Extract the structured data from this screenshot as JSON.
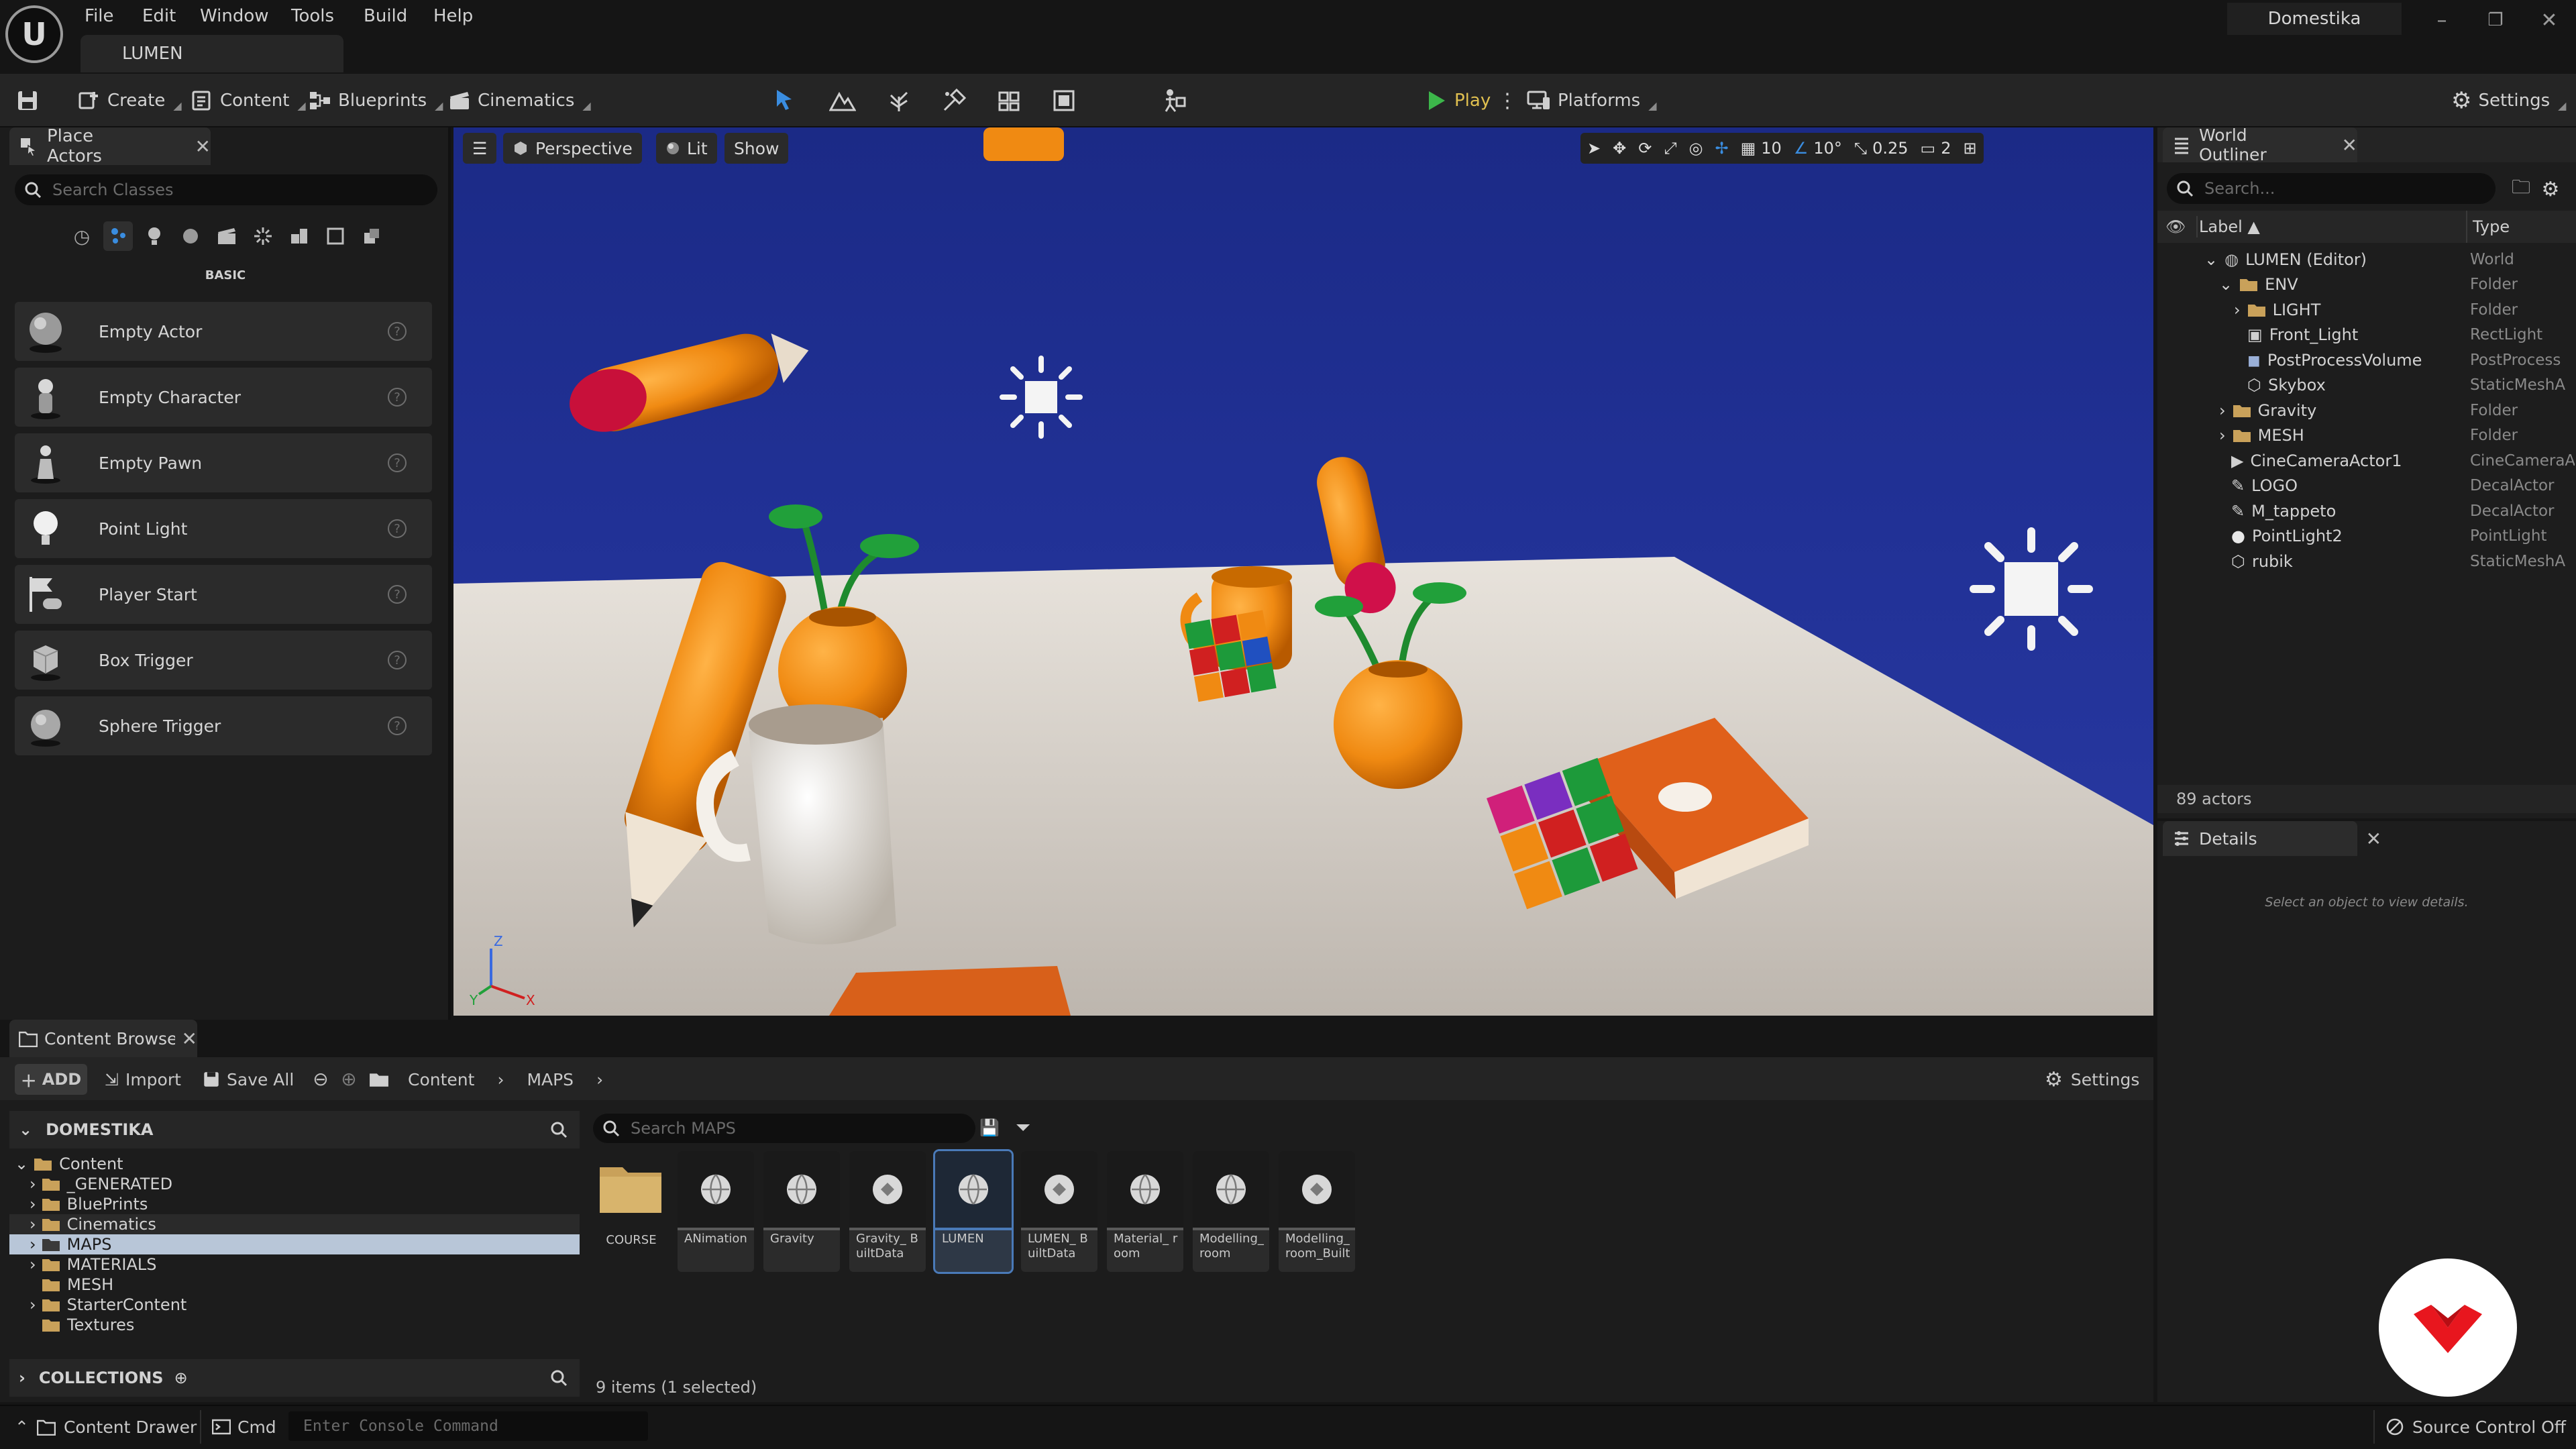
{
  "app": {
    "logo_letter": "U",
    "level_tab": "LUMEN",
    "user": "Domestika"
  },
  "menu": [
    "File",
    "Edit",
    "Window",
    "Tools",
    "Build",
    "Help"
  ],
  "toolbar": {
    "create": "Create",
    "content": "Content",
    "blueprints": "Blueprints",
    "cinematics": "Cinematics",
    "play": "Play",
    "platforms": "Platforms",
    "settings": "Settings"
  },
  "place_actors": {
    "title": "Place Actors",
    "search_placeholder": "Search Classes",
    "category": "BASIC",
    "items": [
      "Empty Actor",
      "Empty Character",
      "Empty Pawn",
      "Point Light",
      "Player Start",
      "Box Trigger",
      "Sphere Trigger"
    ]
  },
  "viewport": {
    "perspective": "Perspective",
    "lit": "Lit",
    "show": "Show",
    "grid_size": "10",
    "rotation_snap": "10°",
    "scale_snap": "0.25",
    "camera_speed": "2",
    "axis_z": "Z",
    "axis_x": "X",
    "axis_y": "Y"
  },
  "outliner": {
    "title": "World Outliner",
    "search_placeholder": "Search...",
    "col_label": "Label ▲",
    "col_type": "Type",
    "rows": [
      {
        "label": "LUMEN (Editor)",
        "type": "World",
        "icon": "world-icon"
      },
      {
        "label": "ENV",
        "type": "Folder",
        "icon": "folder-icon"
      },
      {
        "label": "LIGHT",
        "type": "Folder",
        "icon": "folder-icon"
      },
      {
        "label": "Front_Light",
        "type": "RectLight",
        "icon": "rect-light-icon"
      },
      {
        "label": "PostProcessVolume",
        "type": "PostProcess",
        "icon": "postprocess-icon"
      },
      {
        "label": "Skybox",
        "type": "StaticMeshA",
        "icon": "mesh-icon"
      },
      {
        "label": "Gravity",
        "type": "Folder",
        "icon": "folder-icon"
      },
      {
        "label": "MESH",
        "type": "Folder",
        "icon": "folder-icon"
      },
      {
        "label": "CineCameraActor1",
        "type": "CineCameraA",
        "icon": "camera-icon"
      },
      {
        "label": "LOGO",
        "type": "DecalActor",
        "icon": "decal-icon"
      },
      {
        "label": "M_tappeto",
        "type": "DecalActor",
        "icon": "decal-icon"
      },
      {
        "label": "PointLight2",
        "type": "PointLight",
        "icon": "light-bulb-icon"
      },
      {
        "label": "rubik",
        "type": "StaticMeshA",
        "icon": "mesh-icon"
      }
    ],
    "actor_count": "89 actors"
  },
  "details": {
    "title": "Details",
    "empty_message": "Select an object to view details."
  },
  "content_browser": {
    "title": "Content Browser",
    "add": "ADD",
    "import": "Import",
    "save_all": "Save All",
    "breadcrumb": [
      "Content",
      "MAPS"
    ],
    "settings": "Settings",
    "source_root": "DOMESTIKA",
    "tree": [
      "Content",
      "_GENERATED",
      "BluePrints",
      "Cinematics",
      "MAPS",
      "MATERIALS",
      "MESH",
      "StarterContent",
      "Textures"
    ],
    "collections": "COLLECTIONS",
    "search_placeholder": "Search MAPS",
    "assets": [
      {
        "name": "COURSE",
        "kind": "folder"
      },
      {
        "name": "ANimation",
        "kind": "map"
      },
      {
        "name": "Gravity",
        "kind": "map"
      },
      {
        "name": "Gravity_ BuiltData",
        "kind": "data"
      },
      {
        "name": "LUMEN",
        "kind": "map"
      },
      {
        "name": "LUMEN_ BuiltData",
        "kind": "data"
      },
      {
        "name": "Material_ room",
        "kind": "map"
      },
      {
        "name": "Modelling_ room",
        "kind": "map"
      },
      {
        "name": "Modelling_ room_Built",
        "kind": "data"
      }
    ],
    "status": "9 items (1 selected)"
  },
  "statusbar": {
    "content_drawer": "Content Drawer",
    "cmd": "Cmd",
    "console_placeholder": "Enter Console Command",
    "source_control": "Source Control Off"
  },
  "colors": {
    "accent": "#4a7ab8",
    "play_green": "#3cb64a",
    "sky": "#213196",
    "brand_red": "#e8161e"
  }
}
